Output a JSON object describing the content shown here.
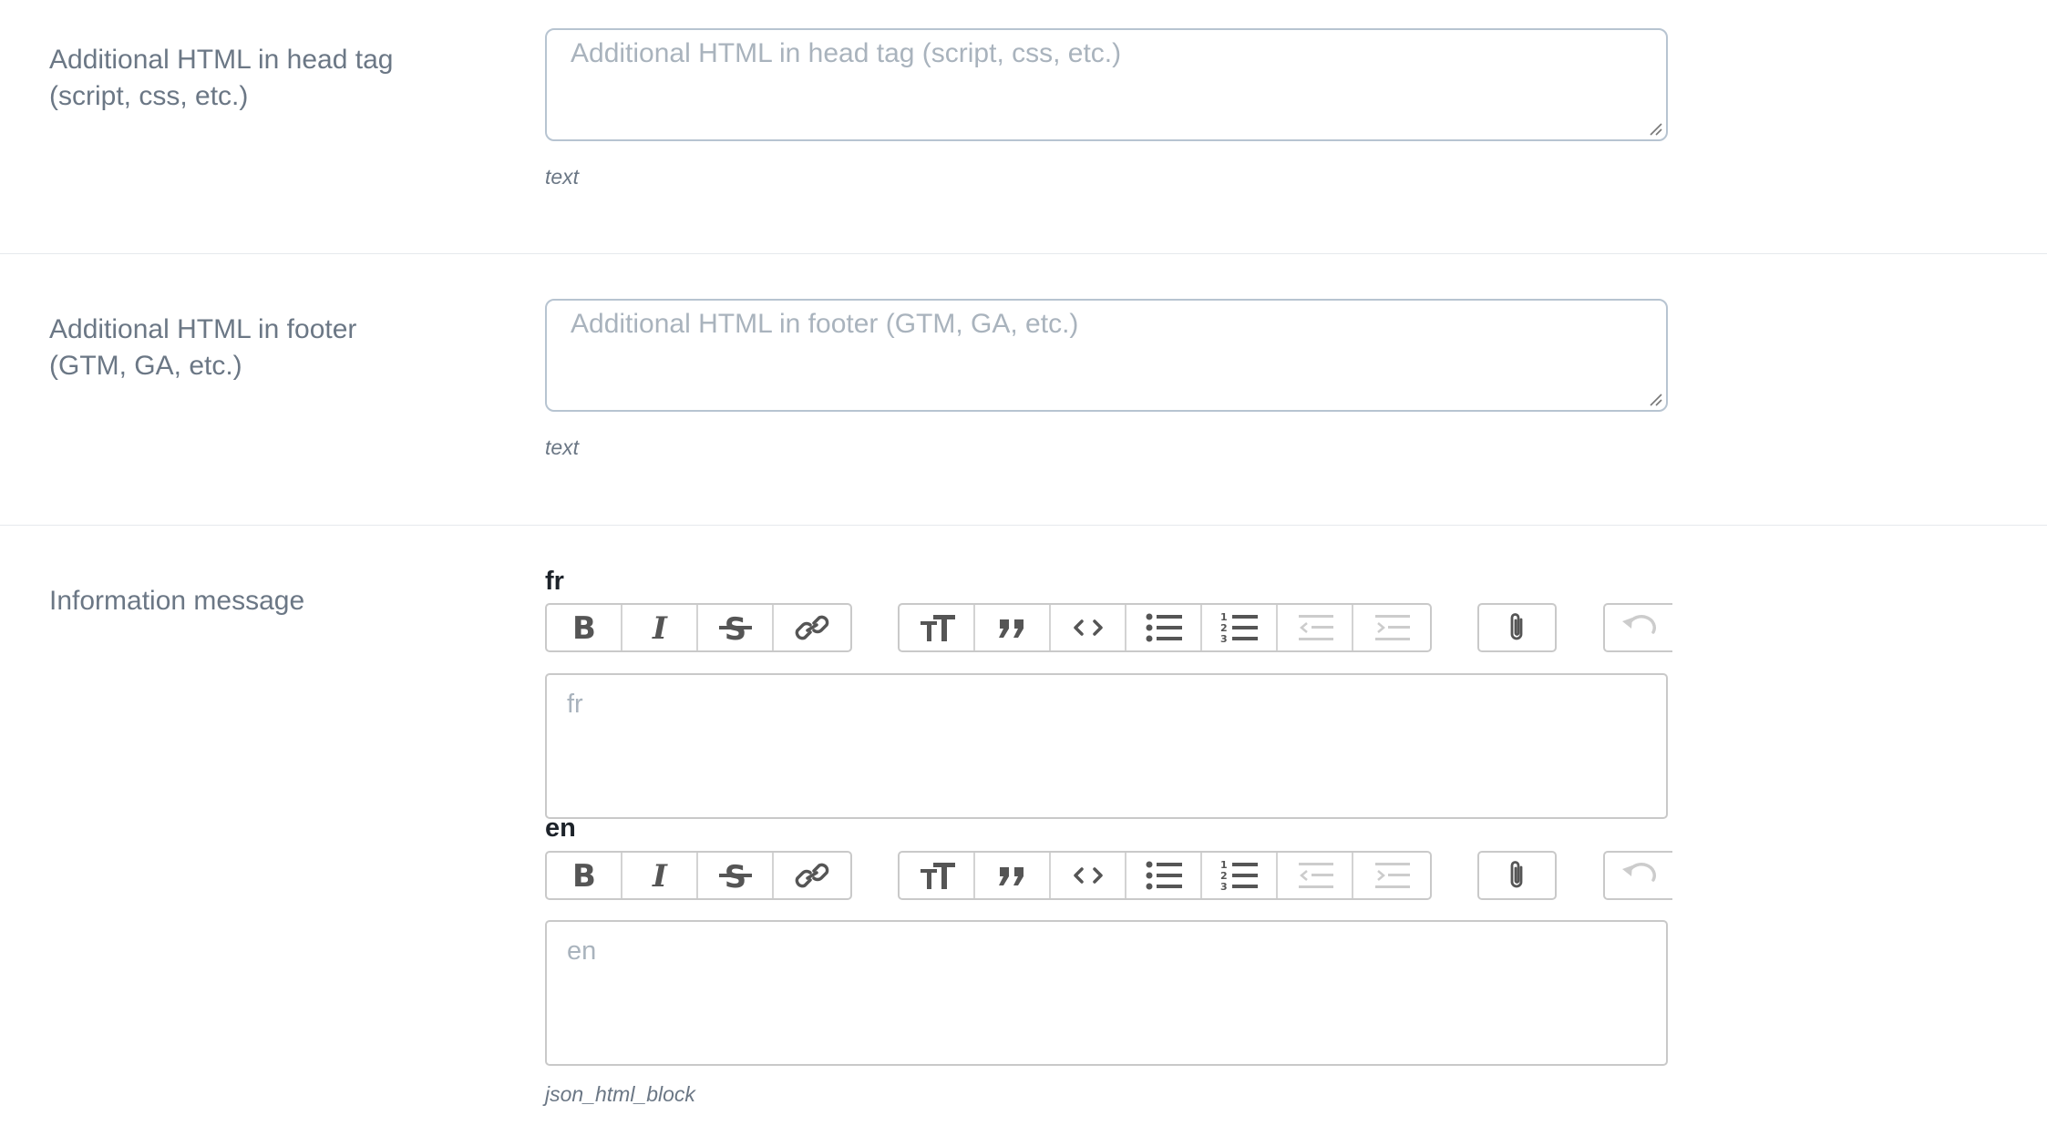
{
  "fields": [
    {
      "label_line1": "Additional HTML in head tag",
      "label_line2": "(script, css, etc.)",
      "placeholder": "Additional HTML in head tag (script, css, etc.)",
      "type_hint": "text"
    },
    {
      "label_line1": "Additional HTML in footer",
      "label_line2": "(GTM, GA, etc.)",
      "placeholder": "Additional HTML in footer (GTM, GA, etc.)",
      "type_hint": "text"
    }
  ],
  "info_message": {
    "label": "Information message",
    "type_hint": "json_html_block",
    "editors": [
      {
        "lang": "fr",
        "placeholder": "fr"
      },
      {
        "lang": "en",
        "placeholder": "en"
      }
    ],
    "toolbar": {
      "text_group": [
        "bold-icon",
        "italic-icon",
        "strikethrough-icon",
        "link-icon"
      ],
      "block_group": [
        "heading-icon",
        "quote-icon",
        "code-icon",
        "bullet-list-icon",
        "numbered-list-icon",
        "outdent-icon",
        "indent-icon"
      ],
      "file_group": [
        "attach-icon"
      ],
      "history_group": [
        "undo-icon"
      ],
      "icon_color": "#555555",
      "disabled_color": "#cccccc"
    }
  }
}
